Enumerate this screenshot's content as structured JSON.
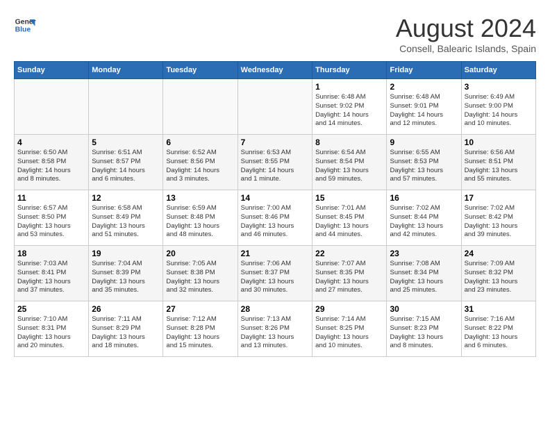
{
  "header": {
    "logo_line1": "General",
    "logo_line2": "Blue",
    "title": "August 2024",
    "subtitle": "Consell, Balearic Islands, Spain"
  },
  "weekdays": [
    "Sunday",
    "Monday",
    "Tuesday",
    "Wednesday",
    "Thursday",
    "Friday",
    "Saturday"
  ],
  "weeks": [
    [
      {
        "day": "",
        "info": ""
      },
      {
        "day": "",
        "info": ""
      },
      {
        "day": "",
        "info": ""
      },
      {
        "day": "",
        "info": ""
      },
      {
        "day": "1",
        "info": "Sunrise: 6:48 AM\nSunset: 9:02 PM\nDaylight: 14 hours\nand 14 minutes."
      },
      {
        "day": "2",
        "info": "Sunrise: 6:48 AM\nSunset: 9:01 PM\nDaylight: 14 hours\nand 12 minutes."
      },
      {
        "day": "3",
        "info": "Sunrise: 6:49 AM\nSunset: 9:00 PM\nDaylight: 14 hours\nand 10 minutes."
      }
    ],
    [
      {
        "day": "4",
        "info": "Sunrise: 6:50 AM\nSunset: 8:58 PM\nDaylight: 14 hours\nand 8 minutes."
      },
      {
        "day": "5",
        "info": "Sunrise: 6:51 AM\nSunset: 8:57 PM\nDaylight: 14 hours\nand 6 minutes."
      },
      {
        "day": "6",
        "info": "Sunrise: 6:52 AM\nSunset: 8:56 PM\nDaylight: 14 hours\nand 3 minutes."
      },
      {
        "day": "7",
        "info": "Sunrise: 6:53 AM\nSunset: 8:55 PM\nDaylight: 14 hours\nand 1 minute."
      },
      {
        "day": "8",
        "info": "Sunrise: 6:54 AM\nSunset: 8:54 PM\nDaylight: 13 hours\nand 59 minutes."
      },
      {
        "day": "9",
        "info": "Sunrise: 6:55 AM\nSunset: 8:53 PM\nDaylight: 13 hours\nand 57 minutes."
      },
      {
        "day": "10",
        "info": "Sunrise: 6:56 AM\nSunset: 8:51 PM\nDaylight: 13 hours\nand 55 minutes."
      }
    ],
    [
      {
        "day": "11",
        "info": "Sunrise: 6:57 AM\nSunset: 8:50 PM\nDaylight: 13 hours\nand 53 minutes."
      },
      {
        "day": "12",
        "info": "Sunrise: 6:58 AM\nSunset: 8:49 PM\nDaylight: 13 hours\nand 51 minutes."
      },
      {
        "day": "13",
        "info": "Sunrise: 6:59 AM\nSunset: 8:48 PM\nDaylight: 13 hours\nand 48 minutes."
      },
      {
        "day": "14",
        "info": "Sunrise: 7:00 AM\nSunset: 8:46 PM\nDaylight: 13 hours\nand 46 minutes."
      },
      {
        "day": "15",
        "info": "Sunrise: 7:01 AM\nSunset: 8:45 PM\nDaylight: 13 hours\nand 44 minutes."
      },
      {
        "day": "16",
        "info": "Sunrise: 7:02 AM\nSunset: 8:44 PM\nDaylight: 13 hours\nand 42 minutes."
      },
      {
        "day": "17",
        "info": "Sunrise: 7:02 AM\nSunset: 8:42 PM\nDaylight: 13 hours\nand 39 minutes."
      }
    ],
    [
      {
        "day": "18",
        "info": "Sunrise: 7:03 AM\nSunset: 8:41 PM\nDaylight: 13 hours\nand 37 minutes."
      },
      {
        "day": "19",
        "info": "Sunrise: 7:04 AM\nSunset: 8:39 PM\nDaylight: 13 hours\nand 35 minutes."
      },
      {
        "day": "20",
        "info": "Sunrise: 7:05 AM\nSunset: 8:38 PM\nDaylight: 13 hours\nand 32 minutes."
      },
      {
        "day": "21",
        "info": "Sunrise: 7:06 AM\nSunset: 8:37 PM\nDaylight: 13 hours\nand 30 minutes."
      },
      {
        "day": "22",
        "info": "Sunrise: 7:07 AM\nSunset: 8:35 PM\nDaylight: 13 hours\nand 27 minutes."
      },
      {
        "day": "23",
        "info": "Sunrise: 7:08 AM\nSunset: 8:34 PM\nDaylight: 13 hours\nand 25 minutes."
      },
      {
        "day": "24",
        "info": "Sunrise: 7:09 AM\nSunset: 8:32 PM\nDaylight: 13 hours\nand 23 minutes."
      }
    ],
    [
      {
        "day": "25",
        "info": "Sunrise: 7:10 AM\nSunset: 8:31 PM\nDaylight: 13 hours\nand 20 minutes."
      },
      {
        "day": "26",
        "info": "Sunrise: 7:11 AM\nSunset: 8:29 PM\nDaylight: 13 hours\nand 18 minutes."
      },
      {
        "day": "27",
        "info": "Sunrise: 7:12 AM\nSunset: 8:28 PM\nDaylight: 13 hours\nand 15 minutes."
      },
      {
        "day": "28",
        "info": "Sunrise: 7:13 AM\nSunset: 8:26 PM\nDaylight: 13 hours\nand 13 minutes."
      },
      {
        "day": "29",
        "info": "Sunrise: 7:14 AM\nSunset: 8:25 PM\nDaylight: 13 hours\nand 10 minutes."
      },
      {
        "day": "30",
        "info": "Sunrise: 7:15 AM\nSunset: 8:23 PM\nDaylight: 13 hours\nand 8 minutes."
      },
      {
        "day": "31",
        "info": "Sunrise: 7:16 AM\nSunset: 8:22 PM\nDaylight: 13 hours\nand 6 minutes."
      }
    ]
  ]
}
